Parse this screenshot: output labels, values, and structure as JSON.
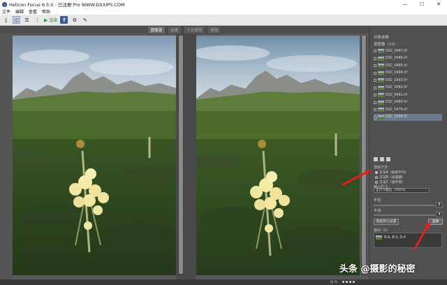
{
  "window": {
    "title": "Helicon Focus 6.5.0 - 已注册 Pro  WWW.DXXIPS.COM",
    "min_label": "—",
    "max_label": "☐",
    "close_label": "✕"
  },
  "menu": [
    "文件",
    "编辑",
    "查看",
    "帮助"
  ],
  "toolbar": {
    "render_label": "渲染"
  },
  "tabs": [
    "图像源",
    "结果",
    "人为修饰",
    "修改"
  ],
  "right_panel": {
    "title": "对象参数",
    "sources_label": "源图像（10）:",
    "files": [
      "DSC_0487.tif",
      "DSC_0486.tif",
      "DSC_0485.tif",
      "DSC_0484.tif",
      "DSC_0483.tif",
      "DSC_0482.tif",
      "DSC_0481.tif",
      "DSC_0480.tif",
      "DSC_0479.tif",
      "DSC_0398.tif"
    ],
    "render_method_label": "渲染方法：",
    "methods": [
      "方法A（加权平均）",
      "方法B（深度图）",
      "方法C（金字塔）"
    ],
    "radius_label": "缩小尺寸：",
    "radius_combo": "全尺寸输出（100%）",
    "radius_field_label": "半径：",
    "radius_value": "8",
    "smoothing_label": "平滑：",
    "smoothing_value": "4",
    "restore_button": "恢复默认设置",
    "apply_button": "渲染",
    "output_label": "输出（1）",
    "output_item": "B-A, B-S, D-4"
  },
  "status": {
    "zoom_label": "比 %"
  },
  "watermark": "头条 @摄影的秘密",
  "colors": {
    "annotation": "#e0211b",
    "background": "#585858",
    "panel": "#505050"
  }
}
